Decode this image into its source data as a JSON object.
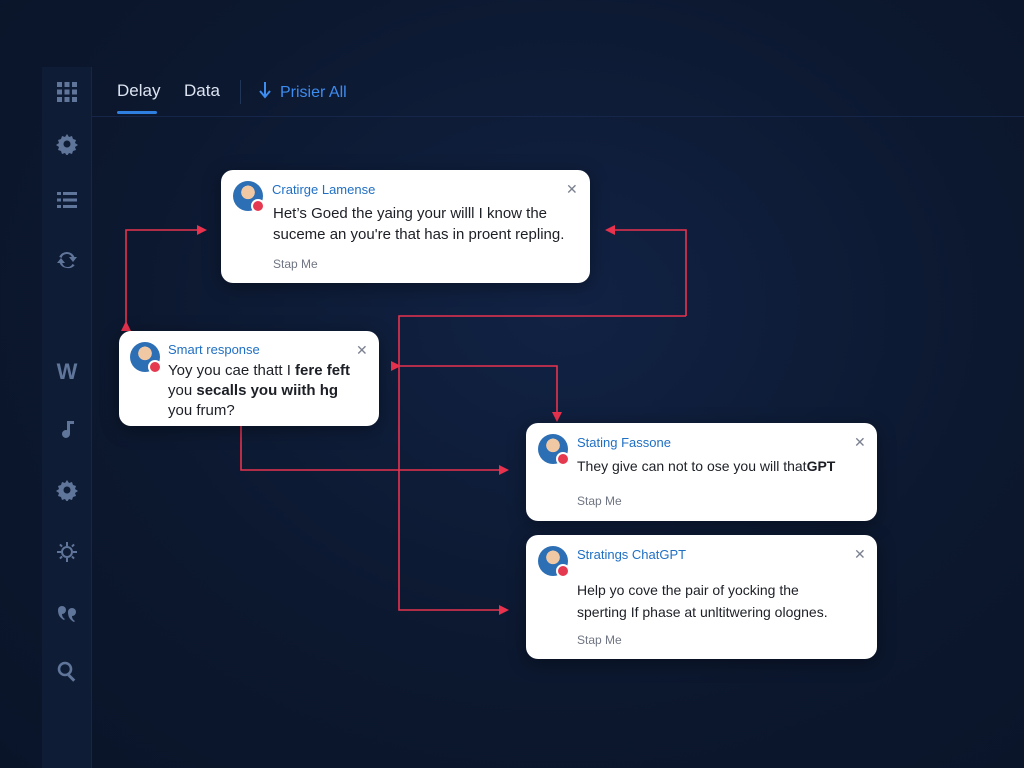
{
  "tabs": [
    {
      "label": "Delay",
      "active": true
    },
    {
      "label": "Data",
      "active": false
    }
  ],
  "toolbar_action": {
    "label": "Prisier All",
    "icon": "arrow-down-icon"
  },
  "sidebar_icons": [
    "grid-icon",
    "gear-icon",
    "list-icon",
    "refresh-icon",
    "w-glyph-icon",
    "music-note-icon",
    "gear-icon",
    "sun-gear-icon",
    "quote-icon",
    "search-icon"
  ],
  "accent_color": "#2f7fe0",
  "connector_color": "#e8324e",
  "cards": [
    {
      "title": "Cratirge Lamense",
      "body_lines": [
        "Het’s Goed the yaing your willl I know the",
        "suceme an you're that has in proent repling."
      ],
      "footer": "Stap Me"
    },
    {
      "title": "Smart response",
      "body_line1_a": "Yoy you cae thatt I ",
      "body_line1_b": "fere feft",
      "body_line2_a": "you ",
      "body_line2_b": "secalls you wiith hg",
      "body_line3": "you frum?"
    },
    {
      "title": "Stating Fassone",
      "body_a": "They give can not to ose you will that",
      "body_b": "GPT",
      "footer": "Stap Me"
    },
    {
      "title": "Stratings ChatGPT",
      "body_lines": [
        "Help yo cove the pair of yocking the",
        "sperting If phase at unltitwering olognes."
      ],
      "footer": "Stap Me"
    }
  ]
}
